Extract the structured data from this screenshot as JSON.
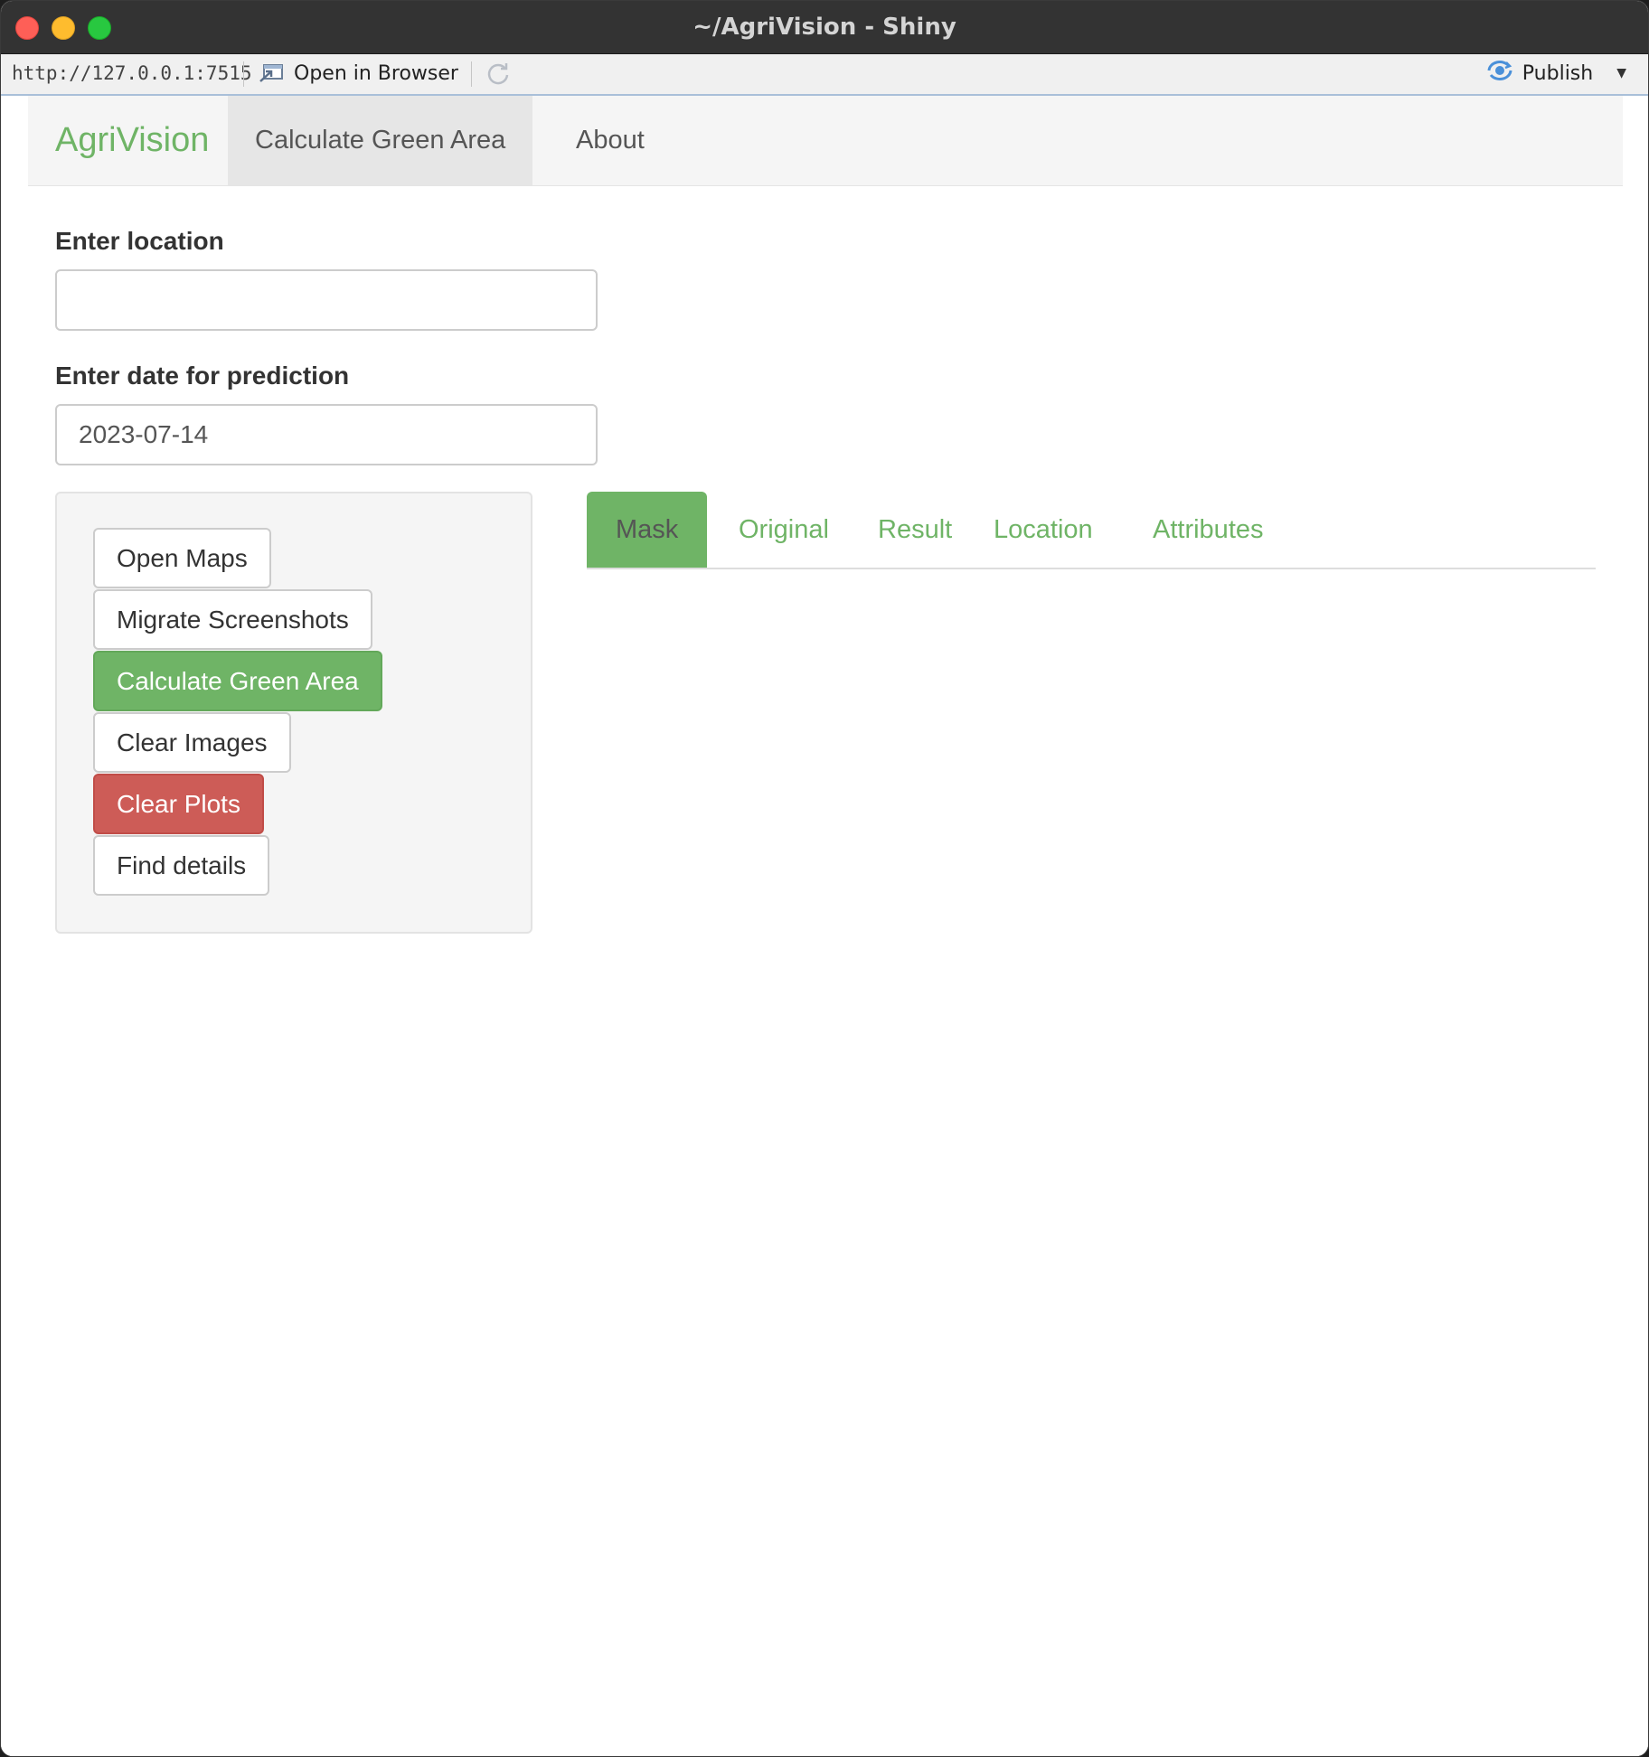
{
  "window": {
    "title": "~/AgriVision - Shiny"
  },
  "toolbar": {
    "url": "http://127.0.0.1:7515",
    "open_in_browser": "Open in Browser",
    "publish": "Publish",
    "icons": [
      "open-in-browser-icon",
      "refresh-icon",
      "publish-icon",
      "caret-down-icon"
    ]
  },
  "navbar": {
    "brand": "AgriVision",
    "items": [
      {
        "label": "Calculate Green Area",
        "active": true
      },
      {
        "label": "About",
        "active": false
      }
    ]
  },
  "form": {
    "location_label": "Enter location",
    "location_value": "",
    "date_label": "Enter date for prediction",
    "date_value": "2023-07-14"
  },
  "buttons": {
    "open_maps": "Open Maps",
    "migrate_screenshots": "Migrate Screenshots",
    "calculate_green_area": "Calculate Green Area",
    "clear_images": "Clear Images",
    "clear_plots": "Clear Plots",
    "find_details": "Find details"
  },
  "tabs": [
    {
      "label": "Mask",
      "active": true
    },
    {
      "label": "Original",
      "active": false
    },
    {
      "label": "Result",
      "active": false
    },
    {
      "label": "Location",
      "active": false
    },
    {
      "label": "Attributes",
      "active": false
    }
  ],
  "colors": {
    "brand_green": "#6fb466",
    "danger_red": "#cd5c57",
    "titlebar": "#333333"
  }
}
